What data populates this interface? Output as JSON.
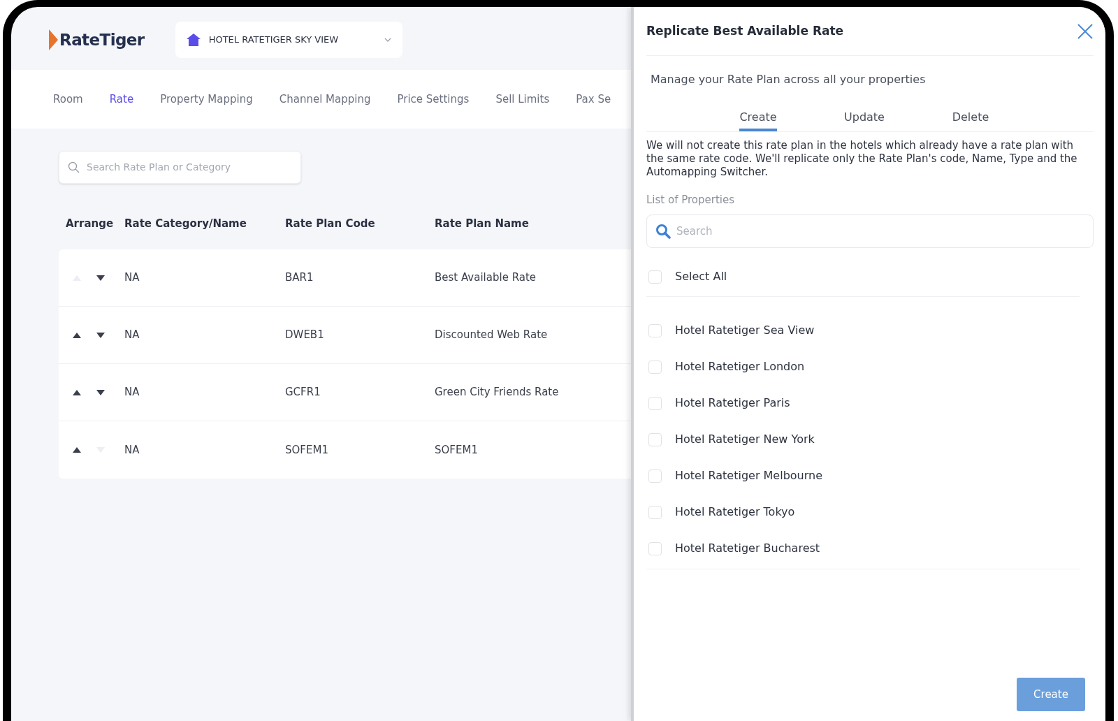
{
  "header": {
    "logo": "RateTiger",
    "hotel_selector": {
      "value": "HOTEL RATETIGER SKY VIEW"
    }
  },
  "nav_tabs": [
    {
      "label": "Room",
      "selected": false
    },
    {
      "label": "Rate",
      "selected": true
    },
    {
      "label": "Property Mapping",
      "selected": false
    },
    {
      "label": "Channel Mapping",
      "selected": false
    },
    {
      "label": "Price Settings",
      "selected": false
    },
    {
      "label": "Sell Limits",
      "selected": false
    },
    {
      "label": "Pax Se",
      "selected": false
    }
  ],
  "search": {
    "placeholder": "Search Rate Plan or Category"
  },
  "table": {
    "columns": [
      "Arrange",
      "Rate Category/Name",
      "Rate Plan Code",
      "Rate Plan Name"
    ],
    "rows": [
      {
        "arrange": {
          "up_disabled": true,
          "down_disabled": false
        },
        "rate_category_name": "NA",
        "rate_plan_code": "BAR1",
        "rate_plan_name": "Best Available Rate"
      },
      {
        "arrange": {
          "up_disabled": false,
          "down_disabled": false
        },
        "rate_category_name": "NA",
        "rate_plan_code": "DWEB1",
        "rate_plan_name": "Discounted Web Rate"
      },
      {
        "arrange": {
          "up_disabled": false,
          "down_disabled": false
        },
        "rate_category_name": "NA",
        "rate_plan_code": "GCFR1",
        "rate_plan_name": "Green City Friends Rate"
      },
      {
        "arrange": {
          "up_disabled": false,
          "down_disabled": true
        },
        "rate_category_name": "NA",
        "rate_plan_code": "SOFEM1",
        "rate_plan_name": "SOFEM1"
      }
    ]
  },
  "panel": {
    "title": "Replicate Best Available Rate",
    "subtitle": "Manage your Rate Plan across all your properties",
    "tabs": [
      {
        "label": "Create",
        "selected": true
      },
      {
        "label": "Update",
        "selected": false
      },
      {
        "label": "Delete",
        "selected": false
      }
    ],
    "notice": "We will not create this rate plan in the hotels which already have a rate plan with the same rate code. We'll replicate only the Rate Plan's code, Name, Type and the Automapping Switcher.",
    "list_label": "List of Properties",
    "search": {
      "placeholder": "Search"
    },
    "select_all": {
      "label": "Select All",
      "checked": false
    },
    "properties": [
      {
        "label": "Hotel Ratetiger Sea View",
        "checked": false
      },
      {
        "label": "Hotel Ratetiger London",
        "checked": false
      },
      {
        "label": "Hotel Ratetiger Paris",
        "checked": false
      },
      {
        "label": "Hotel Ratetiger New York",
        "checked": false
      },
      {
        "label": "Hotel Ratetiger Melbourne",
        "checked": false
      },
      {
        "label": "Hotel Ratetiger Tokyo",
        "checked": false
      },
      {
        "label": "Hotel Ratetiger Bucharest",
        "checked": false
      }
    ],
    "create_button": {
      "label": "Create",
      "disabled": true
    }
  }
}
